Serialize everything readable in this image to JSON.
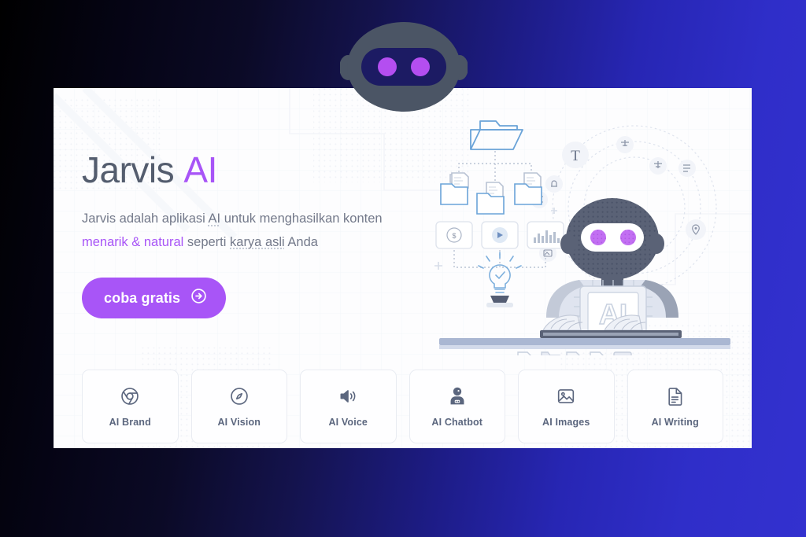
{
  "background": {
    "gradient_from": "#000000",
    "gradient_to": "#3331cf"
  },
  "mascot": {
    "name": "jarvis-robot-logo",
    "body_color": "#4b5565",
    "visor_color": "#1c1b63",
    "eye_color": "#b44ef0"
  },
  "hero": {
    "panel_color": "#fdfdfe",
    "headline": {
      "text_primary": "Jarvis",
      "text_accent": "AI",
      "primary_color": "#545d6e",
      "accent_color": "#a855f7"
    },
    "subcopy": {
      "line1_a": "Jarvis adalah aplikasi ",
      "line1_spell": "AI",
      "line1_b": " untuk menghasilkan konten",
      "line2_accent": "menarik & natural",
      "line2_b": " seperti ",
      "line2_spell": "karya asli",
      "line2_c": " Anda",
      "text_color": "#73798a",
      "accent_color": "#a855f7"
    },
    "cta": {
      "label": "coba gratis",
      "icon": "arrow-right-circle-icon",
      "background": "#a855f7",
      "text_color": "#ffffff"
    }
  },
  "illustration": {
    "name": "ai-robot-workstation-illustration",
    "robot_head_color": "#5a6276",
    "robot_eye_color": "#c26ff2",
    "chip_label": "AI",
    "folder_accent": "#6aa3d8",
    "bulb_accent": "#7eb0dd",
    "orbit_badges": [
      "text-T-icon",
      "sliders-icon",
      "bell-icon",
      "list-icon",
      "location-pin-icon",
      "image-icon",
      "grid-icon"
    ],
    "tile_badges": [
      "dollar-badge-icon",
      "play-button-icon",
      "bar-chart-icon"
    ],
    "bottom_docs": [
      "page-icon",
      "folder-icon",
      "document-lines-icon",
      "page-icon",
      "image-icon"
    ]
  },
  "cards": [
    {
      "label": "AI Brand",
      "icon": "chrome-browser-icon"
    },
    {
      "label": "AI Vision",
      "icon": "compass-icon"
    },
    {
      "label": "AI Voice",
      "icon": "speaker-volume-icon"
    },
    {
      "label": "AI Chatbot",
      "icon": "robot-avatar-icon"
    },
    {
      "label": "AI Images",
      "icon": "image-picture-icon"
    },
    {
      "label": "AI Writing",
      "icon": "document-pen-icon"
    }
  ]
}
